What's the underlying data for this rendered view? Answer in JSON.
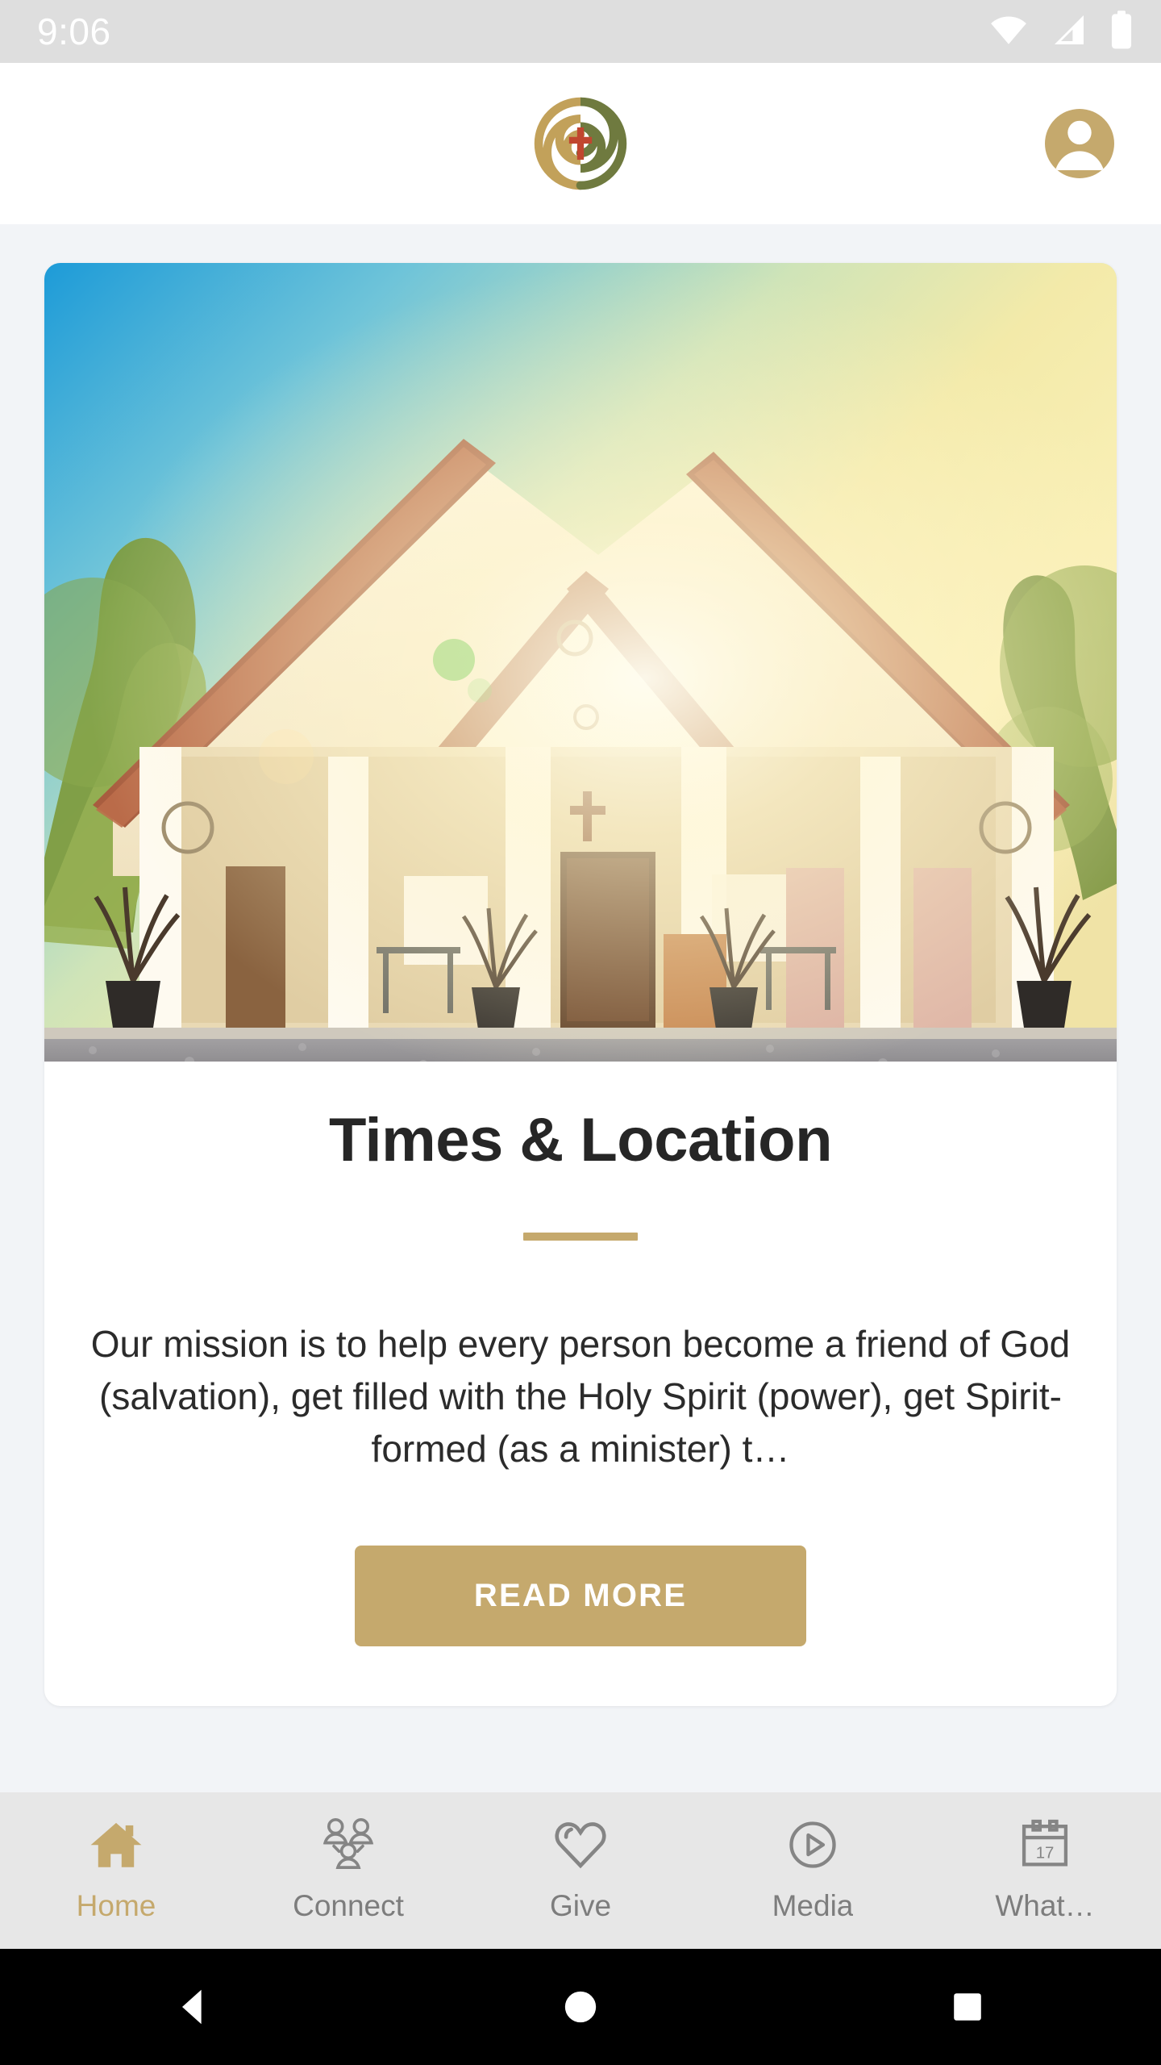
{
  "status_bar": {
    "time": "9:06",
    "icons": [
      "wifi-icon",
      "cellular-signal-icon",
      "battery-icon"
    ],
    "background_color": "#dedede",
    "foreground_color": "#ffffff"
  },
  "header": {
    "logo_name": "church-logo",
    "logo_colors": {
      "gold": "#c2a15a",
      "olive": "#6f7a3f",
      "cross": "#c1462f"
    },
    "avatar_name": "user-avatar",
    "avatar_color": "#c5a96d"
  },
  "hero": {
    "alt": "church-building-photo",
    "description": "Stucco church with terracotta tile roof, white columns and gravel driveway at sunset"
  },
  "card": {
    "title": "Times & Location",
    "divider_color": "#c5a96d",
    "body_text": "Our mission is to help every person become a friend of God (salvation), get filled with the Holy Spirit (power), get Spirit-formed (as a minister) t…",
    "button_label": "READ MORE",
    "button_color": "#c5a96d"
  },
  "tabbar": {
    "active_color": "#c5a96d",
    "inactive_color": "#7d7d7d",
    "background_color": "#e7e7e7",
    "items": [
      {
        "label": "Home",
        "icon": "home-icon",
        "active": true
      },
      {
        "label": "Connect",
        "icon": "group-icon",
        "active": false
      },
      {
        "label": "Give",
        "icon": "heart-icon",
        "active": false
      },
      {
        "label": "Media",
        "icon": "play-icon",
        "active": false
      },
      {
        "label": "What…",
        "icon": "calendar-icon",
        "active": false,
        "calendar_day": "17"
      }
    ]
  },
  "system_nav": {
    "back_label": "back-button",
    "home_label": "home-button",
    "recents_label": "recents-button"
  },
  "theme": {
    "page_background": "#f2f4f7",
    "card_background": "#ffffff",
    "accent": "#c5a96d",
    "text_primary": "#262626"
  }
}
